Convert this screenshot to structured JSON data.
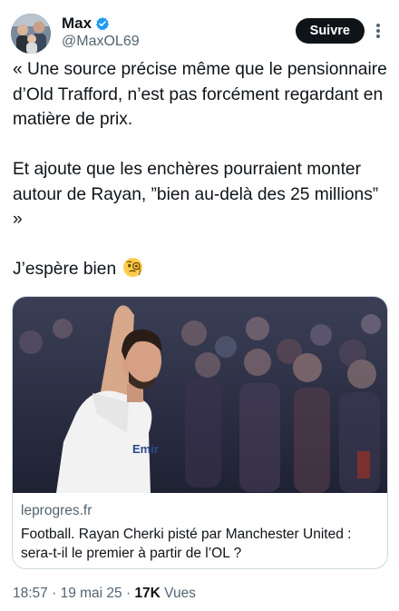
{
  "author": {
    "display_name": "Max",
    "handle": "@MaxOL69",
    "verified_icon": "verified-badge-icon",
    "accent_color": "#1d9bf0"
  },
  "follow_button": {
    "label": "Suivre"
  },
  "tweet": {
    "paragraphs": [
      "« Une source précise même que le pensionnaire d’Old Trafford, n’est pas forcément regardant en matière de prix.",
      "Et ajoute que les enchères pourraient monter autour de Rayan, ”bien au-delà des 25 millions” »",
      "J’espère bien"
    ],
    "final_emoji": "face-with-monocle-emoji"
  },
  "link_card": {
    "domain": "leprogres.fr",
    "title": "Football. Rayan Cherki pisté par Manchester United : sera-t-il le premier à partir de l’OL ?"
  },
  "meta": {
    "time": "18:57",
    "separator": " · ",
    "date": "19 mai 25",
    "views_count": "17K",
    "views_label": " Vues"
  }
}
